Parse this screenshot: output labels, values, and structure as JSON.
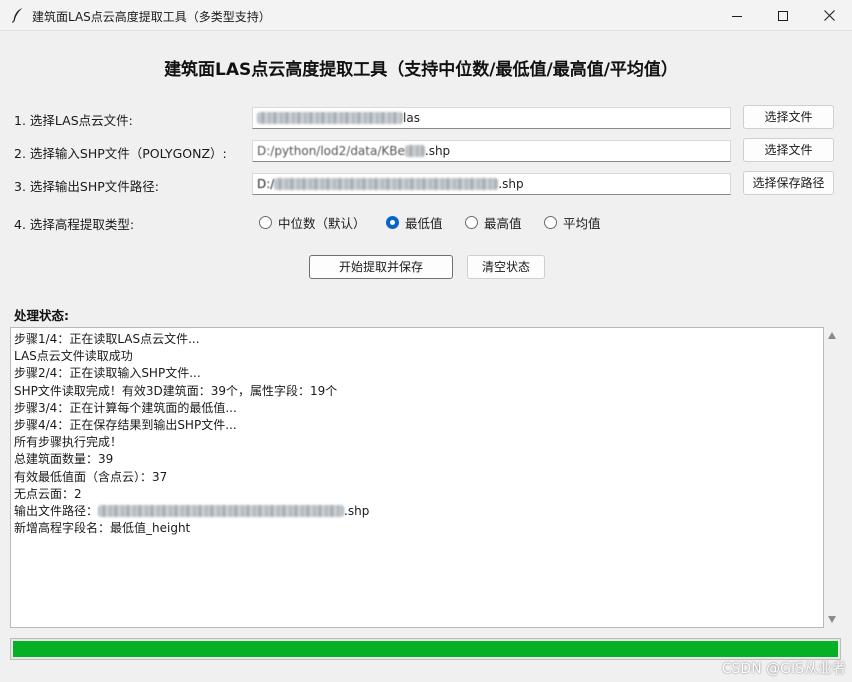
{
  "window": {
    "title": "建筑面LAS点云高度提取工具（多类型支持）",
    "icon": "feather-icon"
  },
  "main_title": "建筑面LAS点云高度提取工具（支持中位数/最低值/最高值/平均值）",
  "rows": {
    "las": {
      "label": "1. 选择LAS点云文件:",
      "value_suffix": "las",
      "button": "选择文件"
    },
    "shp_in": {
      "label": "2. 选择输入SHP文件（POLYGONZ）:",
      "value_visible": "D:/python/lod2/data/KBe",
      "value_suffix": ".shp",
      "button": "选择文件"
    },
    "shp_out": {
      "label": "3. 选择输出SHP文件路径:",
      "value_prefix": "D:/",
      "value_suffix": ".shp",
      "button": "选择保存路径"
    }
  },
  "elevation": {
    "label": "4. 选择高程提取类型:",
    "options": [
      "中位数（默认）",
      "最低值",
      "最高值",
      "平均值"
    ],
    "selected": "最低值"
  },
  "actions": {
    "start": "开始提取并保存",
    "clear": "清空状态"
  },
  "status": {
    "heading": "处理状态:",
    "log": [
      "步骤1/4：正在读取LAS点云文件...",
      "LAS点云文件读取成功",
      "步骤2/4：正在读取输入SHP文件...",
      "SHP文件读取完成！有效3D建筑面：39个，属性字段：19个",
      "步骤3/4：正在计算每个建筑面的最低值...",
      "步骤4/4：正在保存结果到输出SHP文件...",
      "所有步骤执行完成！",
      "总建筑面数量：39",
      "有效最低值面（含点云）：37",
      "无点云面：2"
    ],
    "output_label": "输出文件路径：",
    "output_suffix": ".shp",
    "last_line": "新增高程字段名：最低值_height"
  },
  "progress": {
    "percent": 100,
    "color": "#06b025"
  },
  "watermark": "CSDN @GIS从业者",
  "colors": {
    "radio_selected": "#0a64c8",
    "progress": "#06b025"
  }
}
